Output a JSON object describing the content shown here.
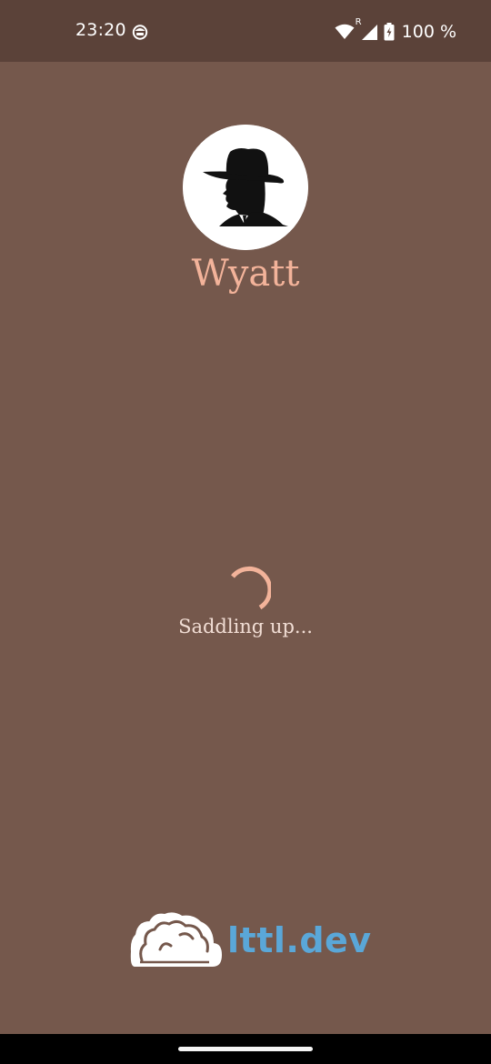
{
  "status_bar": {
    "time": "23:20",
    "app_icon": "notification-app-icon",
    "wifi_icon": "wifi-icon",
    "signal_roaming_label": "R",
    "signal_icon": "cell-signal-icon",
    "battery_icon": "battery-charging-icon",
    "battery_text": "100 %"
  },
  "agent": {
    "avatar_icon": "cowboy-silhouette-avatar",
    "name": "Wyatt"
  },
  "loading": {
    "spinner_icon": "loading-spinner-icon",
    "text": "Saddling up..."
  },
  "brand": {
    "logo_icon": "cloud-logo-icon",
    "text": "lttl.dev"
  },
  "colors": {
    "background": "#75584c",
    "status_bar": "#5b4239",
    "accent": "#f3b39a",
    "brand": "#5aa7d8"
  }
}
